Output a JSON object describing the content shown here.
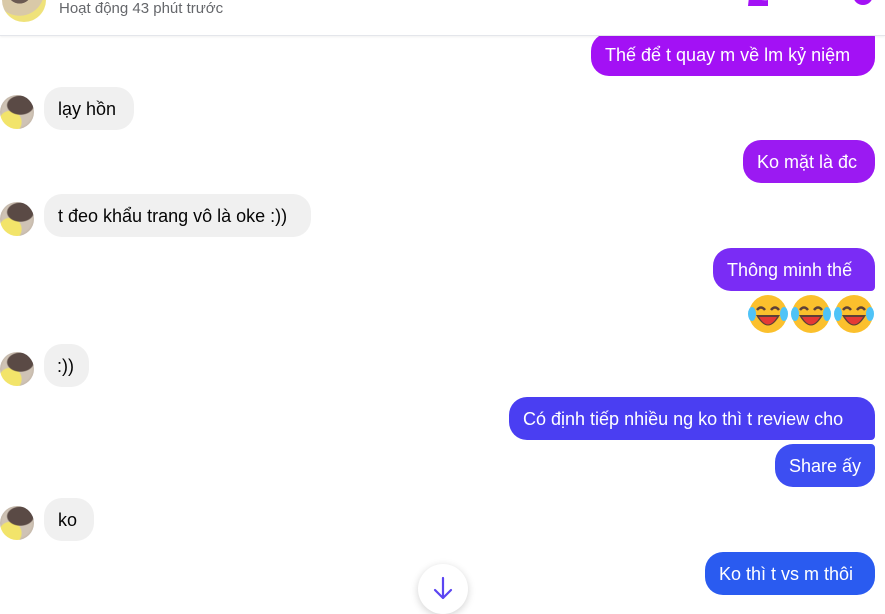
{
  "header": {
    "status": "Hoạt động 43 phút trước",
    "icons": [
      "phone-icon",
      "video-icon",
      "info-icon"
    ]
  },
  "messages": [
    {
      "from": "me",
      "text": "Thế để t quay m về lm kỷ niệm",
      "color": "#a311f5"
    },
    {
      "from": "them",
      "text": "lạy hồn"
    },
    {
      "from": "me",
      "text": "Ko mặt là đc",
      "color": "#9b1af2"
    },
    {
      "from": "them",
      "text": "t đeo khẩu trang vô là oke :))"
    },
    {
      "from": "me",
      "text": "Thông minh thế",
      "color": "#7a2cf5"
    },
    {
      "from": "me",
      "emoji": "face-with-tears-of-joy",
      "count": 3
    },
    {
      "from": "them",
      "text": ":))"
    },
    {
      "from": "me",
      "text": "Có định tiếp nhiều ng ko thì t review cho",
      "color": "#4a3ef2"
    },
    {
      "from": "me",
      "text": "Share ấy",
      "color": "#3d4ef2"
    },
    {
      "from": "them",
      "text": "ko"
    },
    {
      "from": "me",
      "text": "Ko thì t vs m thôi",
      "color": "#2a5bf0"
    }
  ],
  "scroll_button": {
    "icon": "arrow-down-icon"
  }
}
